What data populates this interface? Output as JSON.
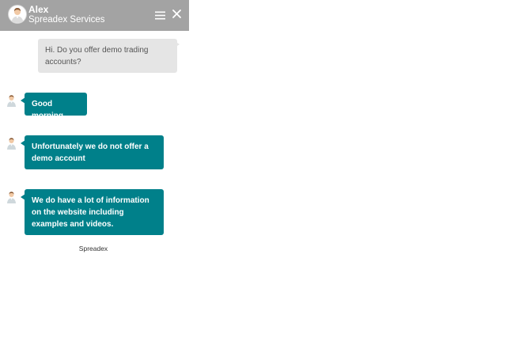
{
  "header": {
    "agent_name": "Alex",
    "company": "Spreadex Services",
    "background_color": "#a3a3a3",
    "icons": [
      "avatar-icon",
      "menu-icon",
      "close-icon"
    ]
  },
  "messages": [
    {
      "sender": "user",
      "text": "Hi. Do you offer demo trading accounts?"
    },
    {
      "sender": "agent",
      "text": "Good morning"
    },
    {
      "sender": "agent",
      "text": "Unfortunately we do not offer a demo account"
    },
    {
      "sender": "agent",
      "text": "We do have a lot of information on the website including examples and videos."
    }
  ],
  "colors": {
    "agent_bubble": "#00808a",
    "user_bubble": "#e5e5e5"
  },
  "footer": {
    "brand": "Spreadex"
  }
}
